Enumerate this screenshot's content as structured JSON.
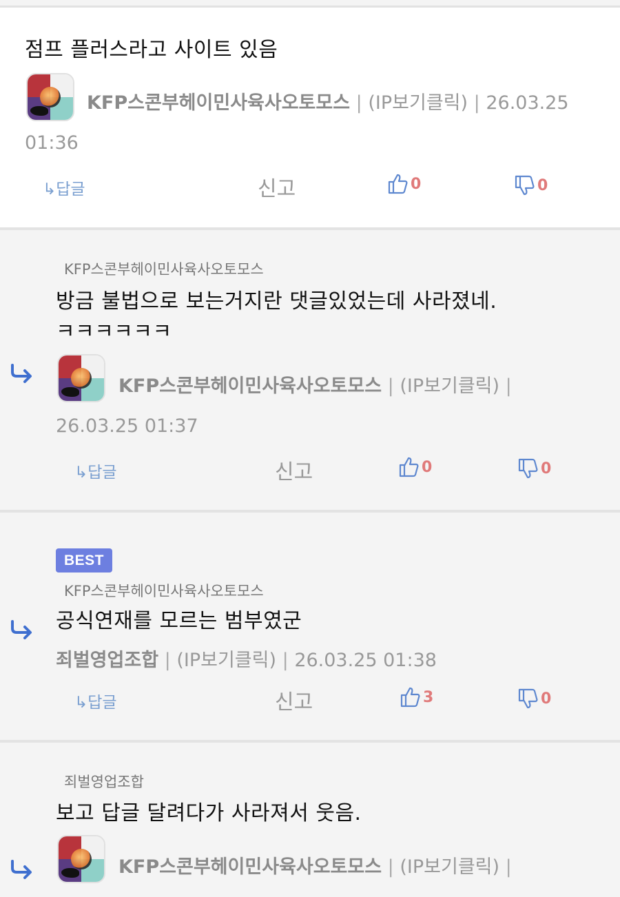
{
  "labels": {
    "reply": "↳답글",
    "report": "신고",
    "separator": "|",
    "ip": "(IP보기클릭)",
    "best": "BEST"
  },
  "comments": [
    {
      "text": "점프 플러스라고 사이트 있음",
      "nick": "KFP스콘부헤이민사육사오토모스",
      "date": "26.03.25",
      "time": "01:36",
      "likes": "0",
      "dislikes": "0"
    },
    {
      "reply_to": "KFP스콘부헤이민사육사오토모스",
      "text": "방금 불법으로 보는거지란 댓글있었는데 사라졌네.",
      "text2": "ㅋㅋㅋㅋㅋㅋ",
      "nick": "KFP스콘부헤이민사육사오토모스",
      "datetime": "26.03.25 01:37",
      "likes": "0",
      "dislikes": "0"
    },
    {
      "reply_to": "KFP스콘부헤이민사육사오토모스",
      "text": "공식연재를 모르는 범부였군",
      "nick": "죄벌영업조합",
      "datetime": "26.03.25 01:38",
      "likes": "3",
      "dislikes": "0"
    },
    {
      "reply_to": "죄벌영업조합",
      "text": "보고 답글 달려다가 사라져서 웃음.",
      "nick": "KFP스콘부헤이민사육사오토모스"
    }
  ],
  "colors": {
    "accent_blue": "#3f6fcf",
    "best_badge": "#6d7fe0",
    "vote_red": "#e07a7a"
  }
}
